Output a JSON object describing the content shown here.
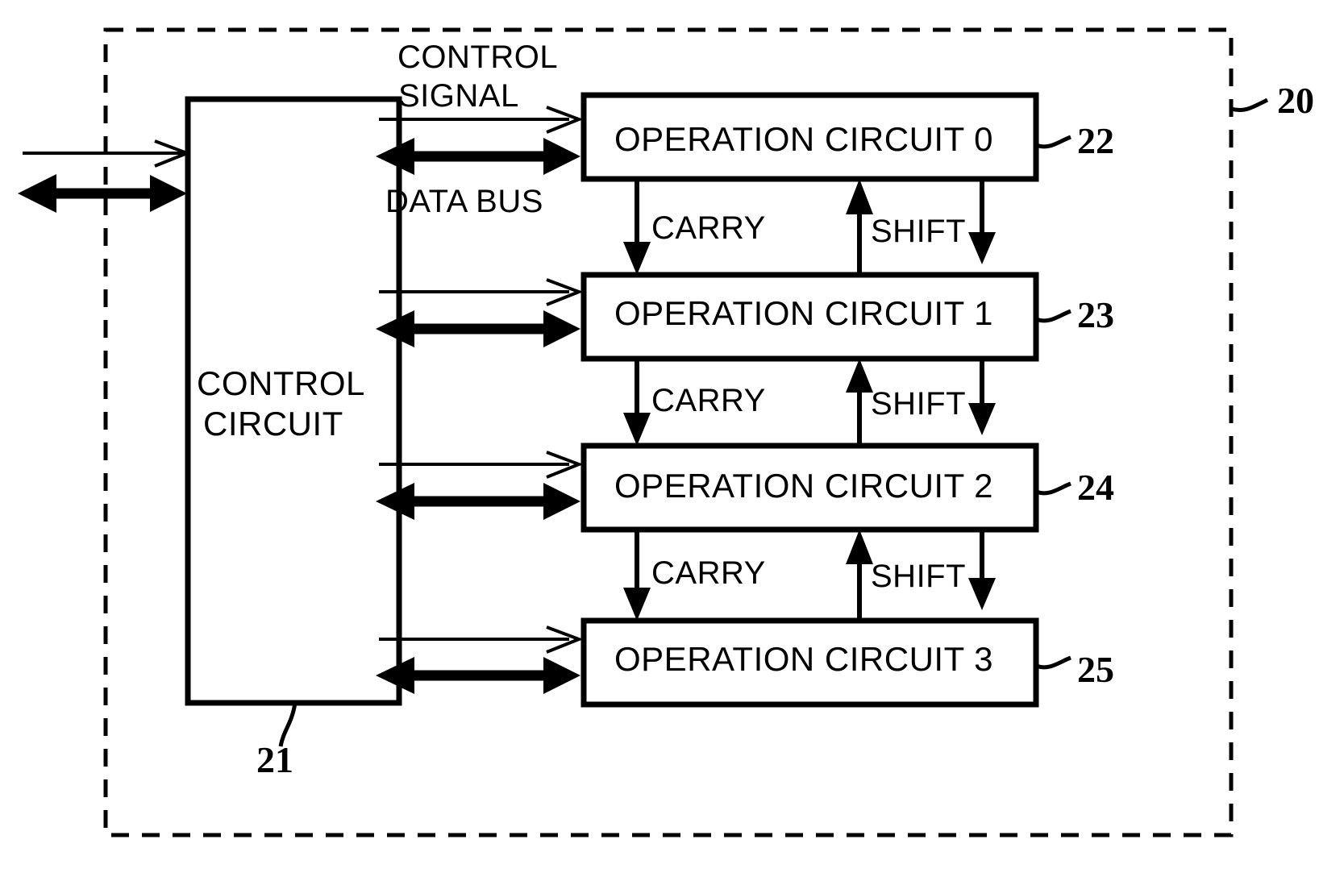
{
  "figure": {
    "outer_boundary_ref": "20",
    "background_color": "#ffffff",
    "line_color": "#000000"
  },
  "blocks": {
    "control_circuit": {
      "label_line1": "CONTROL",
      "label_line2": "CIRCUIT",
      "ref": "21"
    },
    "operation_circuits": [
      {
        "label": "OPERATION CIRCUIT 0",
        "ref": "22"
      },
      {
        "label": "OPERATION CIRCUIT 1",
        "ref": "23"
      },
      {
        "label": "OPERATION CIRCUIT 2",
        "ref": "24"
      },
      {
        "label": "OPERATION CIRCUIT 3",
        "ref": "25"
      }
    ]
  },
  "signals": {
    "control_signal_line1": "CONTROL",
    "control_signal_line2": "SIGNAL",
    "data_bus": "DATA BUS",
    "carry": [
      "CARRY",
      "CARRY",
      "CARRY"
    ],
    "shift": [
      "SHIFT",
      "SHIFT",
      "SHIFT"
    ]
  }
}
